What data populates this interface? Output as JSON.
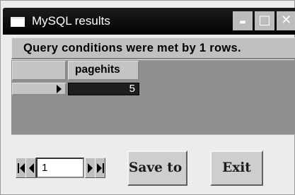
{
  "window": {
    "title": "MySQL results",
    "controls": {
      "minimize": "▬",
      "maximize": "□",
      "close": "✕"
    }
  },
  "status": {
    "message": "Query conditions were met by 1 rows."
  },
  "grid": {
    "columns": [
      "pagehits"
    ],
    "rows": [
      {
        "pagehits": "5"
      }
    ]
  },
  "navigator": {
    "record": "1"
  },
  "buttons": {
    "save": "Save to file",
    "exit": "Exit"
  }
}
